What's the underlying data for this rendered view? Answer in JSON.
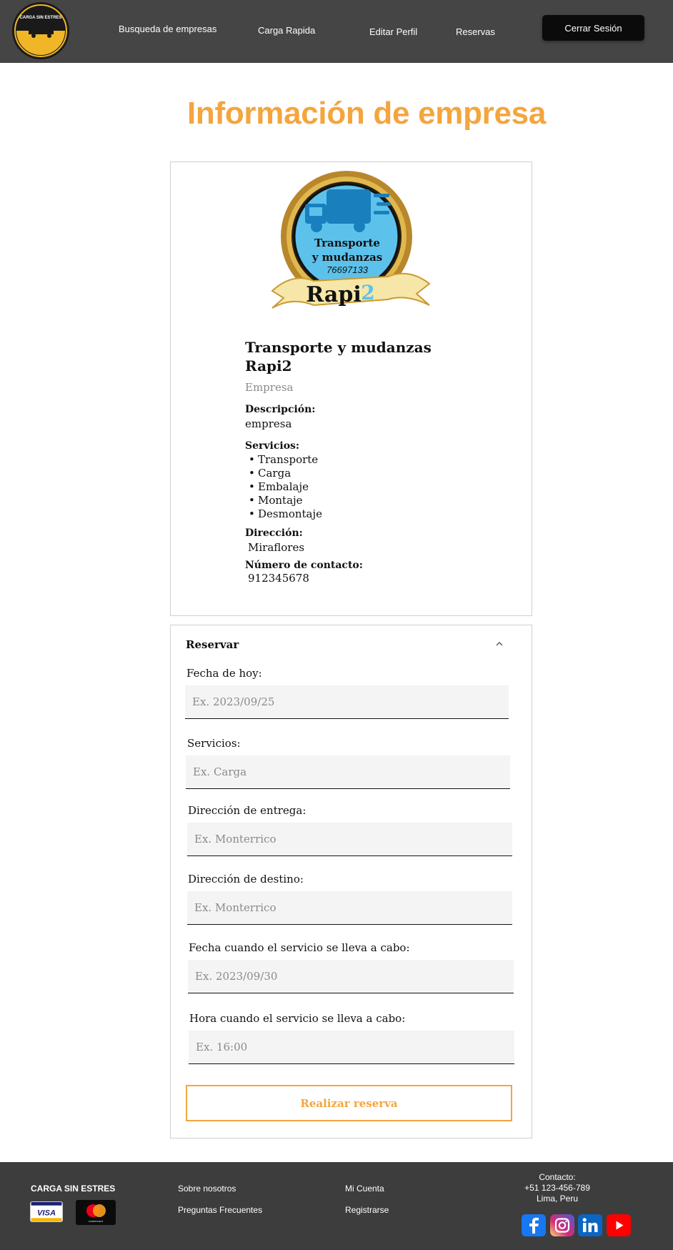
{
  "header": {
    "logo_text": "CARGA SIN ESTRES",
    "nav": {
      "search": "Busqueda de empresas",
      "quick_load": "Carga Rapida",
      "edit_profile": "Editar Perfil",
      "reservations": "Reservas"
    },
    "logout_label": "Cerrar Sesión"
  },
  "page_title": "Información de empresa",
  "company": {
    "logo_line1": "Transporte",
    "logo_line2": "y mudanzas",
    "logo_phone": "76697133",
    "logo_name": "Rapi",
    "logo_number": "2",
    "name_line1": "Transporte y mudanzas",
    "name_line2": "Rapi2",
    "type": "Empresa",
    "description_label": "Descripción:",
    "description": "empresa",
    "services_label": "Servicios:",
    "services": [
      "Transporte",
      "Carga",
      "Embalaje",
      "Montaje",
      "Desmontaje"
    ],
    "address_label": "Dirección:",
    "address": "Miraflores",
    "phone_label": "Número de contacto:",
    "phone": "912345678"
  },
  "reservation": {
    "title": "Reservar",
    "fields": [
      {
        "label": "Fecha de hoy:",
        "placeholder": "Ex. 2023/09/25"
      },
      {
        "label": "Servicios:",
        "placeholder": "Ex. Carga"
      },
      {
        "label": "Dirección de entrega:",
        "placeholder": "Ex. Monterrico"
      },
      {
        "label": "Dirección de destino:",
        "placeholder": "Ex. Monterrico"
      },
      {
        "label": "Fecha cuando el servicio se lleva a cabo:",
        "placeholder": "Ex. 2023/09/30"
      },
      {
        "label": "Hora cuando el servicio se lleva a cabo:",
        "placeholder": "Ex. 16:00"
      }
    ],
    "submit_label": "Realizar reserva"
  },
  "footer": {
    "brand": "CARGA SIN ESTRES",
    "visa_text": "VISA",
    "mastercard_text": "mastercard",
    "links": {
      "about": "Sobre nosotros",
      "faq": "Preguntas Frecuentes",
      "account": "Mi Cuenta",
      "register": "Registrarse"
    },
    "contact_title": "Contacto:",
    "contact_phone": "+51 123-456-789",
    "contact_city": "Lima, Peru",
    "social_icons": [
      "facebook-icon",
      "instagram-icon",
      "linkedin-icon",
      "youtube-icon"
    ]
  },
  "colors": {
    "accent": "#f4a53e",
    "header_bg": "#454545",
    "footer_bg": "#3d3d3d"
  }
}
